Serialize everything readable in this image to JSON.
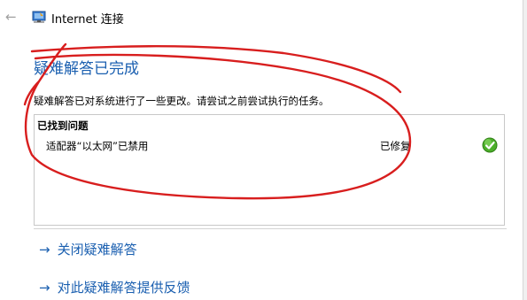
{
  "window": {
    "title": "Internet 连接",
    "back_icon": "back-arrow-icon",
    "app_icon": "network-troubleshooter-icon"
  },
  "main": {
    "heading": "疑难解答已完成",
    "description": "疑难解答已对系统进行了一些更改。请尝试之前尝试执行的任务。",
    "problems": {
      "header": "已找到问题",
      "rows": [
        {
          "name": "适配器“以太网”已禁用",
          "status": "已修复",
          "status_icon": "green-check-icon"
        }
      ]
    }
  },
  "links": [
    {
      "arrow": "→",
      "label": "关闭疑难解答"
    },
    {
      "arrow": "→",
      "label": "对此疑难解答提供反馈"
    }
  ],
  "colors": {
    "accent": "#1a5fb0",
    "annotation_red": "#d81e1e",
    "check_green": "#4caf2a"
  }
}
